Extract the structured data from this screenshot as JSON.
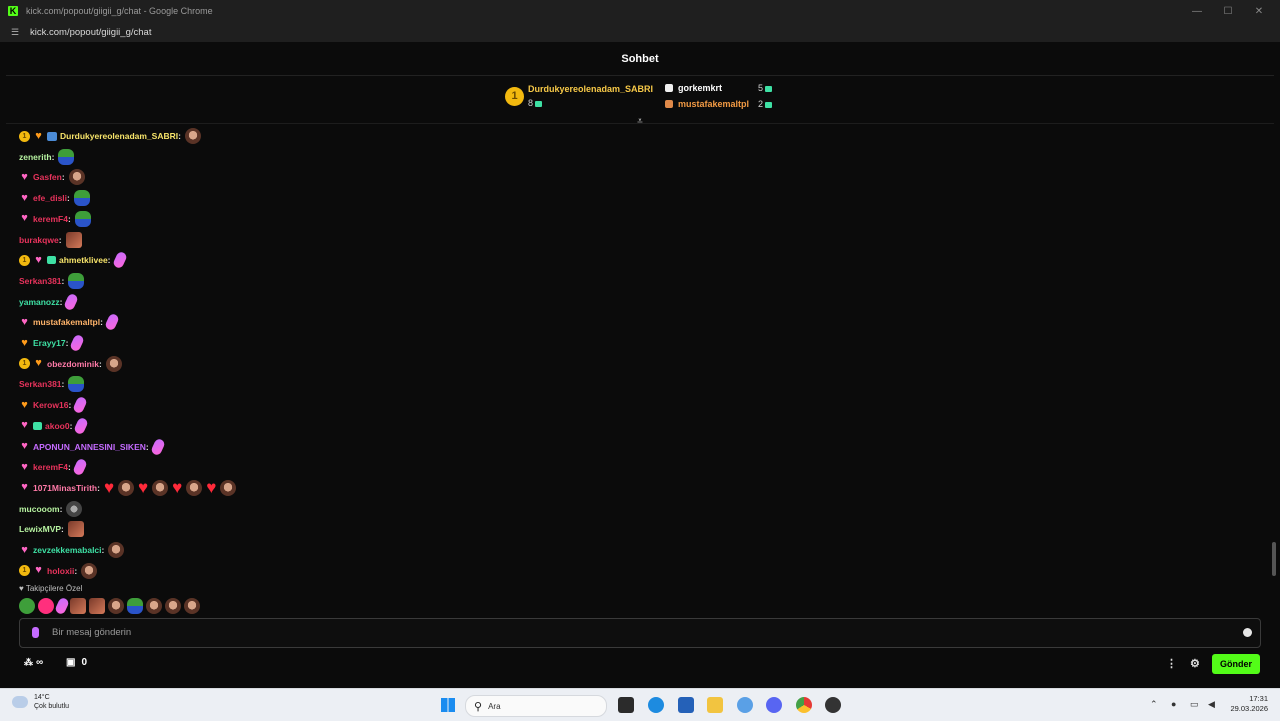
{
  "window": {
    "title": "kick.com/popout/giigii_g/chat - Google Chrome",
    "url": "kick.com/popout/giigii_g/chat"
  },
  "chat": {
    "header_title": "Sohbet",
    "leaderboard": {
      "top": {
        "rank": "1",
        "name": "Durdukyereolenadam_SABRI",
        "count": "8"
      },
      "second": {
        "name": "gorkemkrt",
        "count": "5"
      },
      "third": {
        "name": "mustafakemaltpl",
        "count": "2"
      }
    },
    "messages": [
      {
        "user": "Durdukyereolenadam_SABRI",
        "color": "#f7e46a",
        "badges": [
          "sub",
          "fly-o",
          "img"
        ],
        "emotes": [
          "face"
        ]
      },
      {
        "user": "zenerith",
        "color": "#b7f3a1",
        "badges": [],
        "emotes": [
          "frog"
        ]
      },
      {
        "user": "Gasfen",
        "color": "#e8335c",
        "badges": [
          "fly"
        ],
        "emotes": [
          "face"
        ]
      },
      {
        "user": "efe_disli",
        "color": "#e8335c",
        "badges": [
          "fly"
        ],
        "emotes": [
          "frog"
        ]
      },
      {
        "user": "keremF4",
        "color": "#e8335c",
        "badges": [
          "fly"
        ],
        "emotes": [
          "frog"
        ]
      },
      {
        "user": "burakqwe",
        "color": "#e8335c",
        "badges": [],
        "emotes": [
          "photo"
        ]
      },
      {
        "user": "ahmetklivee",
        "color": "#f7e46a",
        "badges": [
          "sub",
          "fly",
          "gift"
        ],
        "emotes": [
          "feather"
        ]
      },
      {
        "user": "Serkan381",
        "color": "#e8335c",
        "badges": [],
        "emotes": [
          "frog"
        ]
      },
      {
        "user": "yamanozz",
        "color": "#3ee0a4",
        "badges": [],
        "emotes": [
          "feather"
        ]
      },
      {
        "user": "mustafakemaltpl",
        "color": "#ffb46b",
        "badges": [
          "fly"
        ],
        "emotes": [
          "feather"
        ]
      },
      {
        "user": "Erayy17",
        "color": "#3ee0a4",
        "badges": [
          "fly-o"
        ],
        "emotes": [
          "feather"
        ]
      },
      {
        "user": "obezdominik",
        "color": "#ff7aa8",
        "badges": [
          "sub",
          "fly-o"
        ],
        "emotes": [
          "face"
        ]
      },
      {
        "user": "Serkan381",
        "color": "#e8335c",
        "badges": [],
        "emotes": [
          "frog"
        ]
      },
      {
        "user": "Kerow16",
        "color": "#e8335c",
        "badges": [
          "fly-o"
        ],
        "emotes": [
          "feather"
        ]
      },
      {
        "user": "akoo0",
        "color": "#e8335c",
        "badges": [
          "fly",
          "gift"
        ],
        "emotes": [
          "feather"
        ]
      },
      {
        "user": "APONUN_ANNESINI_SIKEN",
        "color": "#c56bff",
        "badges": [
          "fly"
        ],
        "emotes": [
          "feather"
        ]
      },
      {
        "user": "keremF4",
        "color": "#e8335c",
        "badges": [
          "fly"
        ],
        "emotes": [
          "feather"
        ]
      },
      {
        "user": "1071MinasTirith",
        "color": "#ff7aa8",
        "badges": [
          "fly"
        ],
        "emotes": [
          "heart",
          "face",
          "heart",
          "face",
          "heart",
          "face",
          "heart",
          "face"
        ]
      },
      {
        "user": "mucooom",
        "color": "#b7f3a1",
        "badges": [],
        "emotes": [
          "gray"
        ]
      },
      {
        "user": "LewixMVP",
        "color": "#b7f3a1",
        "badges": [],
        "emotes": [
          "photo"
        ]
      },
      {
        "user": "zevzekkemabalci",
        "color": "#3ee0a4",
        "badges": [
          "fly"
        ],
        "emotes": [
          "face"
        ]
      },
      {
        "user": "holoxii",
        "color": "#e8335c",
        "badges": [
          "sub",
          "fly"
        ],
        "emotes": [
          "face"
        ]
      }
    ],
    "followers_label": "Takipçilere Özel",
    "follower_emotes": [
      "frog2",
      "pink",
      "feather",
      "photo",
      "photo",
      "face",
      "frog",
      "face",
      "face",
      "face"
    ],
    "input_placeholder": "Bir mesaj gönderin",
    "infinite_label": "∞",
    "shop_count": "0",
    "send_label": "Gönder"
  },
  "taskbar": {
    "temperature": "14°C",
    "weather_text": "Çok bulutlu",
    "search_placeholder": "Ara",
    "time": "17:31",
    "date": "29.03.2026"
  }
}
